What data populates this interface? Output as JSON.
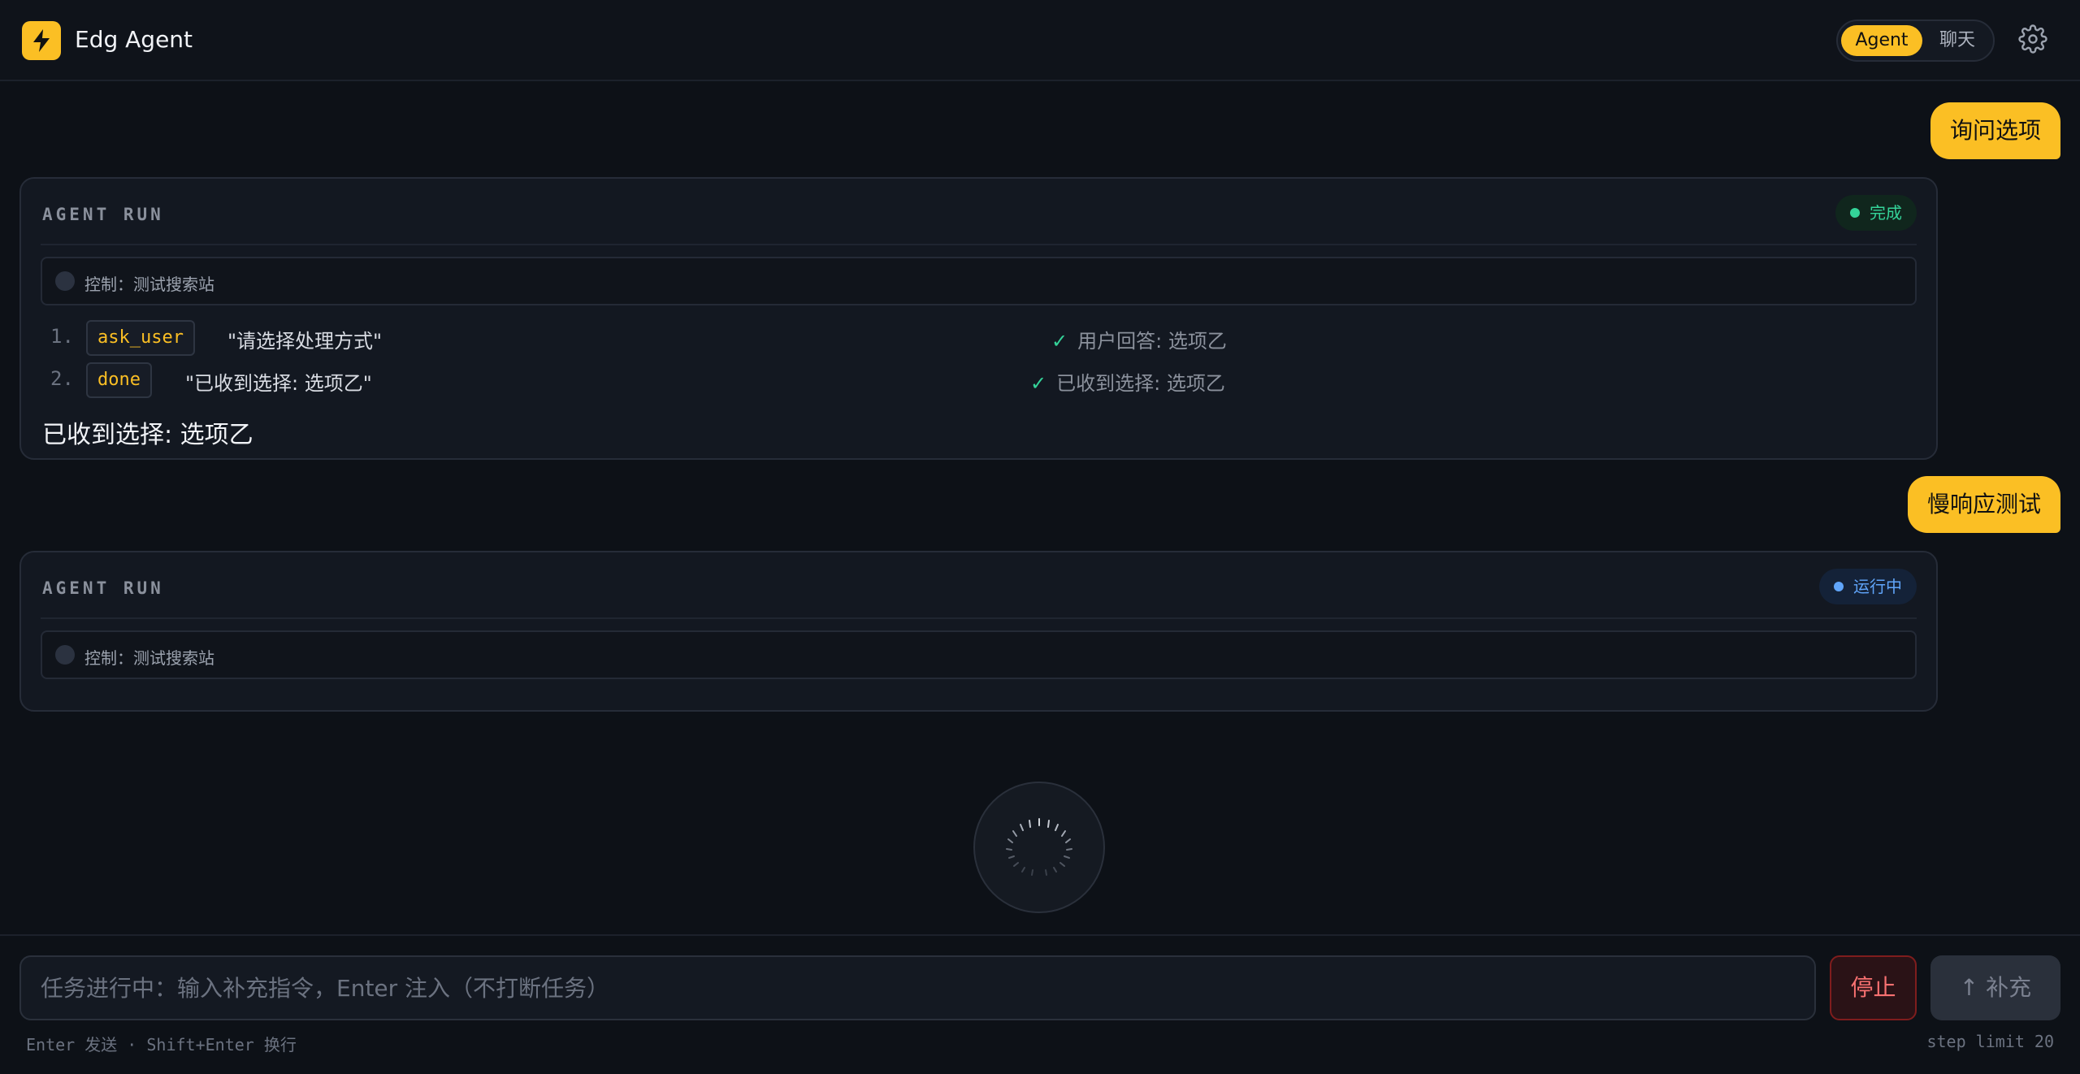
{
  "header": {
    "app_title": "Edg Agent",
    "logo_icon": "lightning-bolt-icon",
    "modes": [
      {
        "label": "Agent",
        "active": true
      },
      {
        "label": "聊天",
        "active": false
      }
    ],
    "settings_icon": "gear-icon"
  },
  "accent_color": "#fbbf24",
  "conversation": [
    {
      "type": "user",
      "text": "询问选项"
    },
    {
      "type": "agent_run",
      "title": "AGENT RUN",
      "status": "完成",
      "status_color": "#34d399",
      "control": "控制：测试搜索站",
      "steps": [
        {
          "num": "1.",
          "action": "ask_user",
          "arg": "\"请选择处理方式\"",
          "result": "用户回答: 选项乙",
          "result_icon": "check-icon"
        },
        {
          "num": "2.",
          "action": "done",
          "arg": "\"已收到选择: 选项乙\"",
          "result": "已收到选择: 选项乙",
          "result_icon": "check-icon"
        }
      ],
      "final": "已收到选择: 选项乙"
    },
    {
      "type": "user",
      "text": "慢响应测试"
    },
    {
      "type": "agent_run",
      "title": "AGENT RUN",
      "status": "运行中",
      "status_color": "#60a5fa",
      "control": "控制：测试搜索站"
    }
  ],
  "composer": {
    "placeholder": "任务进行中：输入补充指令，Enter 注入（不打断任务）",
    "value": "",
    "stop_label": "停止",
    "supplement_label": "补充",
    "supplement_icon": "arrow-up-icon",
    "hint_left": "Enter 发送 · Shift+Enter 换行",
    "hint_right": "step limit 20"
  }
}
